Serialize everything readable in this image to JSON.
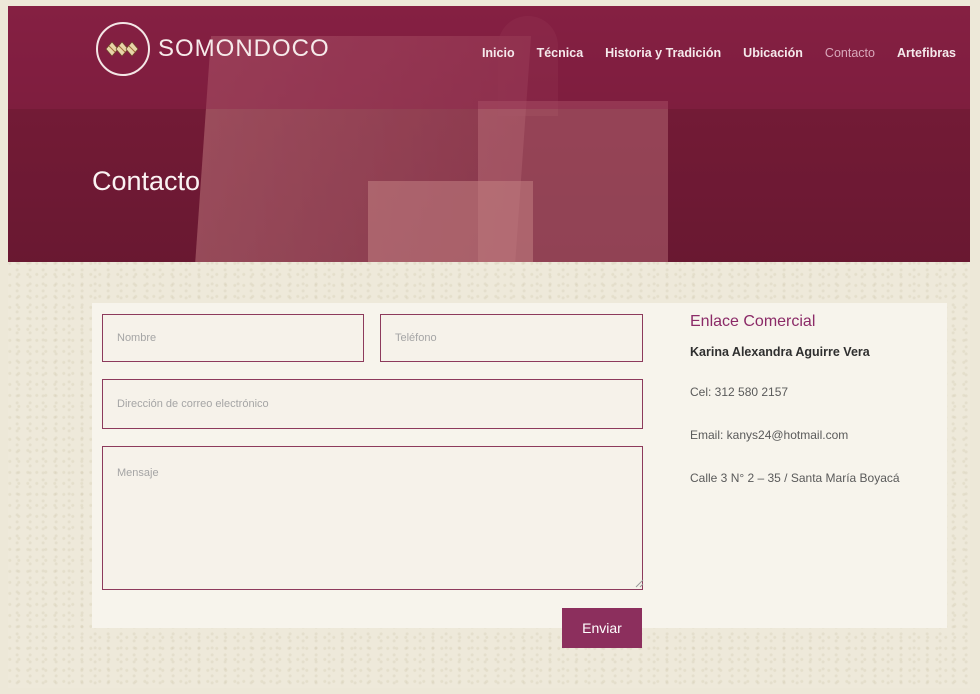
{
  "brand": {
    "name": "SOMONDOCO",
    "logo_icon": "woven-basket-icon"
  },
  "nav": {
    "items": [
      {
        "label": "Inicio"
      },
      {
        "label": "Técnica"
      },
      {
        "label": "Historia y Tradición"
      },
      {
        "label": "Ubicación"
      },
      {
        "label": "Contacto",
        "active": true
      },
      {
        "label": "Artefibras"
      }
    ]
  },
  "page": {
    "title": "Contacto"
  },
  "form": {
    "name_placeholder": "Nombre",
    "phone_placeholder": "Teléfono",
    "email_placeholder": "Dirección de correo electrónico",
    "message_placeholder": "Mensaje",
    "submit_label": "Enviar"
  },
  "contact_info": {
    "heading": "Enlace Comercial",
    "person": "Karina Alexandra Aguirre Vera",
    "phone": "Cel: 312 580 2157",
    "email": "Email: kanys24@hotmail.com",
    "address": "Calle 3 N° 2 – 35  / Santa María Boyacá"
  },
  "colors": {
    "header_maroon": "#7b1f3b",
    "accent": "#8c2f5d",
    "heading_purple": "#8b2a67",
    "background": "#eee9da"
  }
}
